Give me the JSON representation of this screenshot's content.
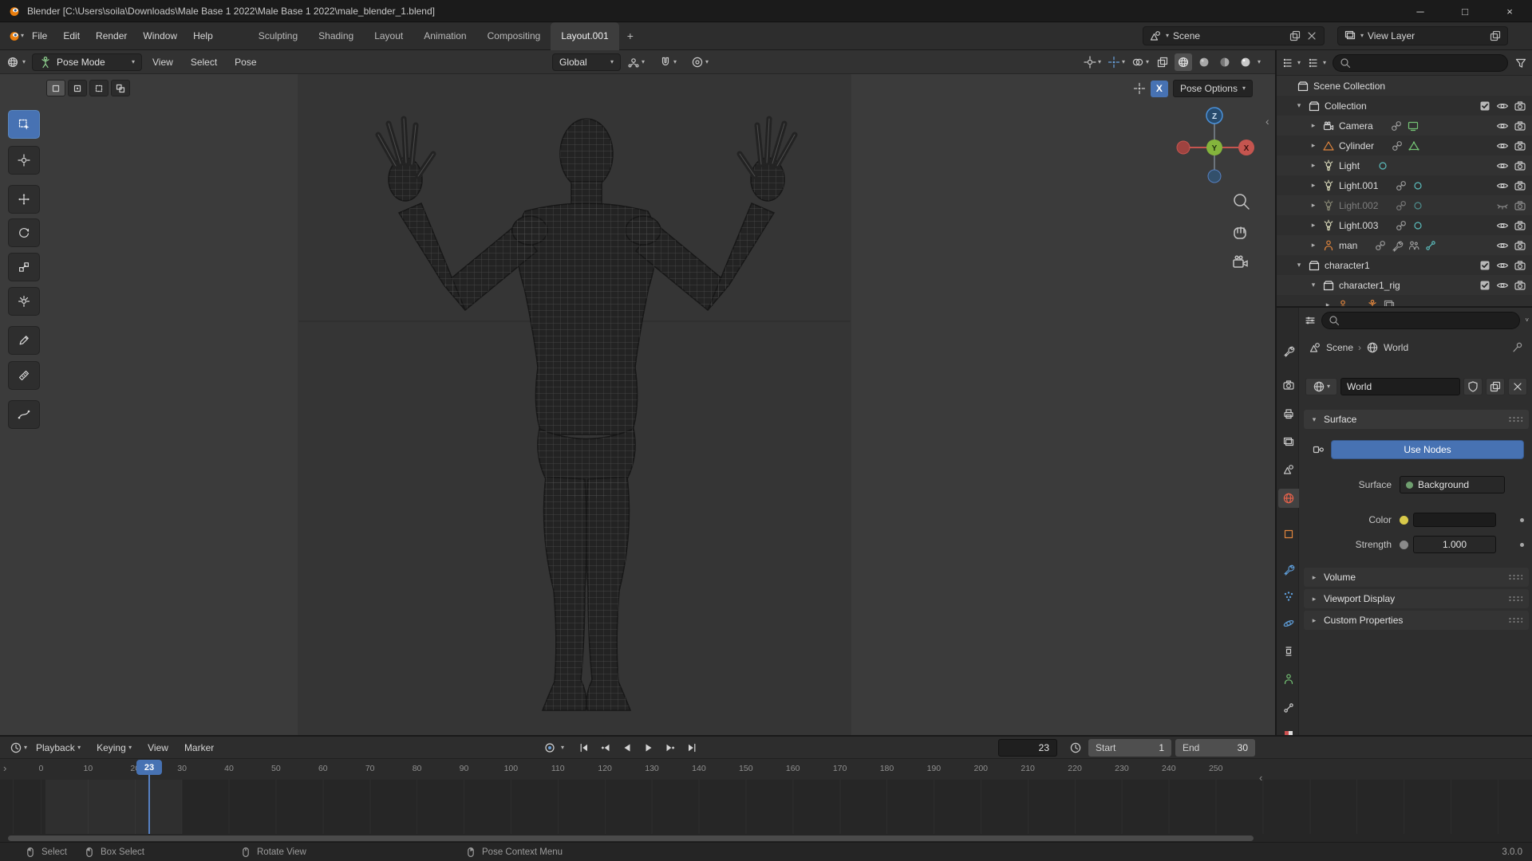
{
  "colors": {
    "accent": "#4772b3",
    "blender_orange": "#e87d0d",
    "axis_red": "#c5554f",
    "axis_green": "#84b43c",
    "axis_blue": "#4a90d9"
  },
  "titlebar": {
    "title": "Blender [C:\\Users\\soila\\Downloads\\Male Base 1 2022\\Male Base 1 2022\\male_blender_1.blend]",
    "minimize": "─",
    "maximize": "□",
    "close": "×"
  },
  "topbar": {
    "menus": [
      "File",
      "Edit",
      "Render",
      "Window",
      "Help"
    ],
    "workspaces": [
      "Sculpting",
      "Shading",
      "Layout",
      "Animation",
      "Compositing",
      "Layout.001"
    ],
    "add_workspace": "+",
    "scene_label": "Scene",
    "view_layer_label": "View Layer"
  },
  "viewport": {
    "mode": "Pose Mode",
    "menus": [
      "View",
      "Select",
      "Pose"
    ],
    "orientation": "Global",
    "mirror_badge": "X",
    "pose_options": "Pose Options",
    "axis": {
      "x": "X",
      "y": "Y",
      "z": "Z"
    }
  },
  "outliner": {
    "rows": [
      {
        "name": "Scene Collection"
      },
      {
        "name": "Collection"
      },
      {
        "name": "Camera"
      },
      {
        "name": "Cylinder"
      },
      {
        "name": "Light"
      },
      {
        "name": "Light.001"
      },
      {
        "name": "Light.002"
      },
      {
        "name": "Light.003"
      },
      {
        "name": "man"
      },
      {
        "name": "character1"
      },
      {
        "name": "character1_rig"
      }
    ]
  },
  "properties": {
    "breadcrumb": {
      "scene": "Scene",
      "world": "World"
    },
    "world_name": "World",
    "surface": {
      "title": "Surface",
      "use_nodes": "Use Nodes",
      "surface_label": "Surface",
      "surface_value": "Background",
      "color_label": "Color",
      "strength_label": "Strength",
      "strength_value": "1.000"
    },
    "collapsed_sections": [
      "Volume",
      "Viewport Display",
      "Custom Properties"
    ]
  },
  "timeline": {
    "menus": [
      "Playback",
      "Keying",
      "View",
      "Marker"
    ],
    "current_frame": "23",
    "playhead_label": "23",
    "start_label": "Start",
    "start_value": "1",
    "end_label": "End",
    "end_value": "30",
    "ticks": [
      "0",
      "10",
      "20",
      "30",
      "40",
      "50",
      "60",
      "70",
      "80",
      "90",
      "100",
      "110",
      "120",
      "130",
      "140",
      "150",
      "160",
      "170",
      "180",
      "190",
      "200",
      "210",
      "220",
      "230",
      "240",
      "250"
    ]
  },
  "statusbar": {
    "labels": [
      "Select",
      "Box Select",
      "Rotate View",
      "Pose Context Menu"
    ],
    "version": "3.0.0"
  }
}
